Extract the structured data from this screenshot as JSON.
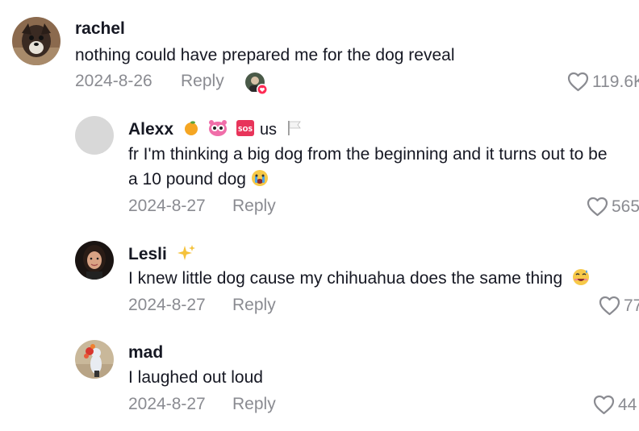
{
  "comments": [
    {
      "username": "rachel",
      "text": "nothing could have prepared me for the dog reveal",
      "date": "2024-8-26",
      "reply_label": "Reply",
      "likes": "119.6K"
    },
    {
      "username": "Alexx",
      "username_suffix": "us",
      "text_line1": "fr I'm thinking a big dog from the beginning and it turns out to be",
      "text_line2": "a 10 pound dog",
      "date": "2024-8-27",
      "reply_label": "Reply",
      "likes": "565"
    },
    {
      "username": "Lesli",
      "text": "I knew little dog cause my chihuahua does the same thing",
      "date": "2024-8-27",
      "reply_label": "Reply",
      "likes": "77"
    },
    {
      "username": "mad",
      "text": "I laughed out loud",
      "date": "2024-8-27",
      "reply_label": "Reply",
      "likes": "44"
    }
  ],
  "icons": {
    "heart": "heart-outline-icon",
    "sos_badge": "SOS"
  }
}
